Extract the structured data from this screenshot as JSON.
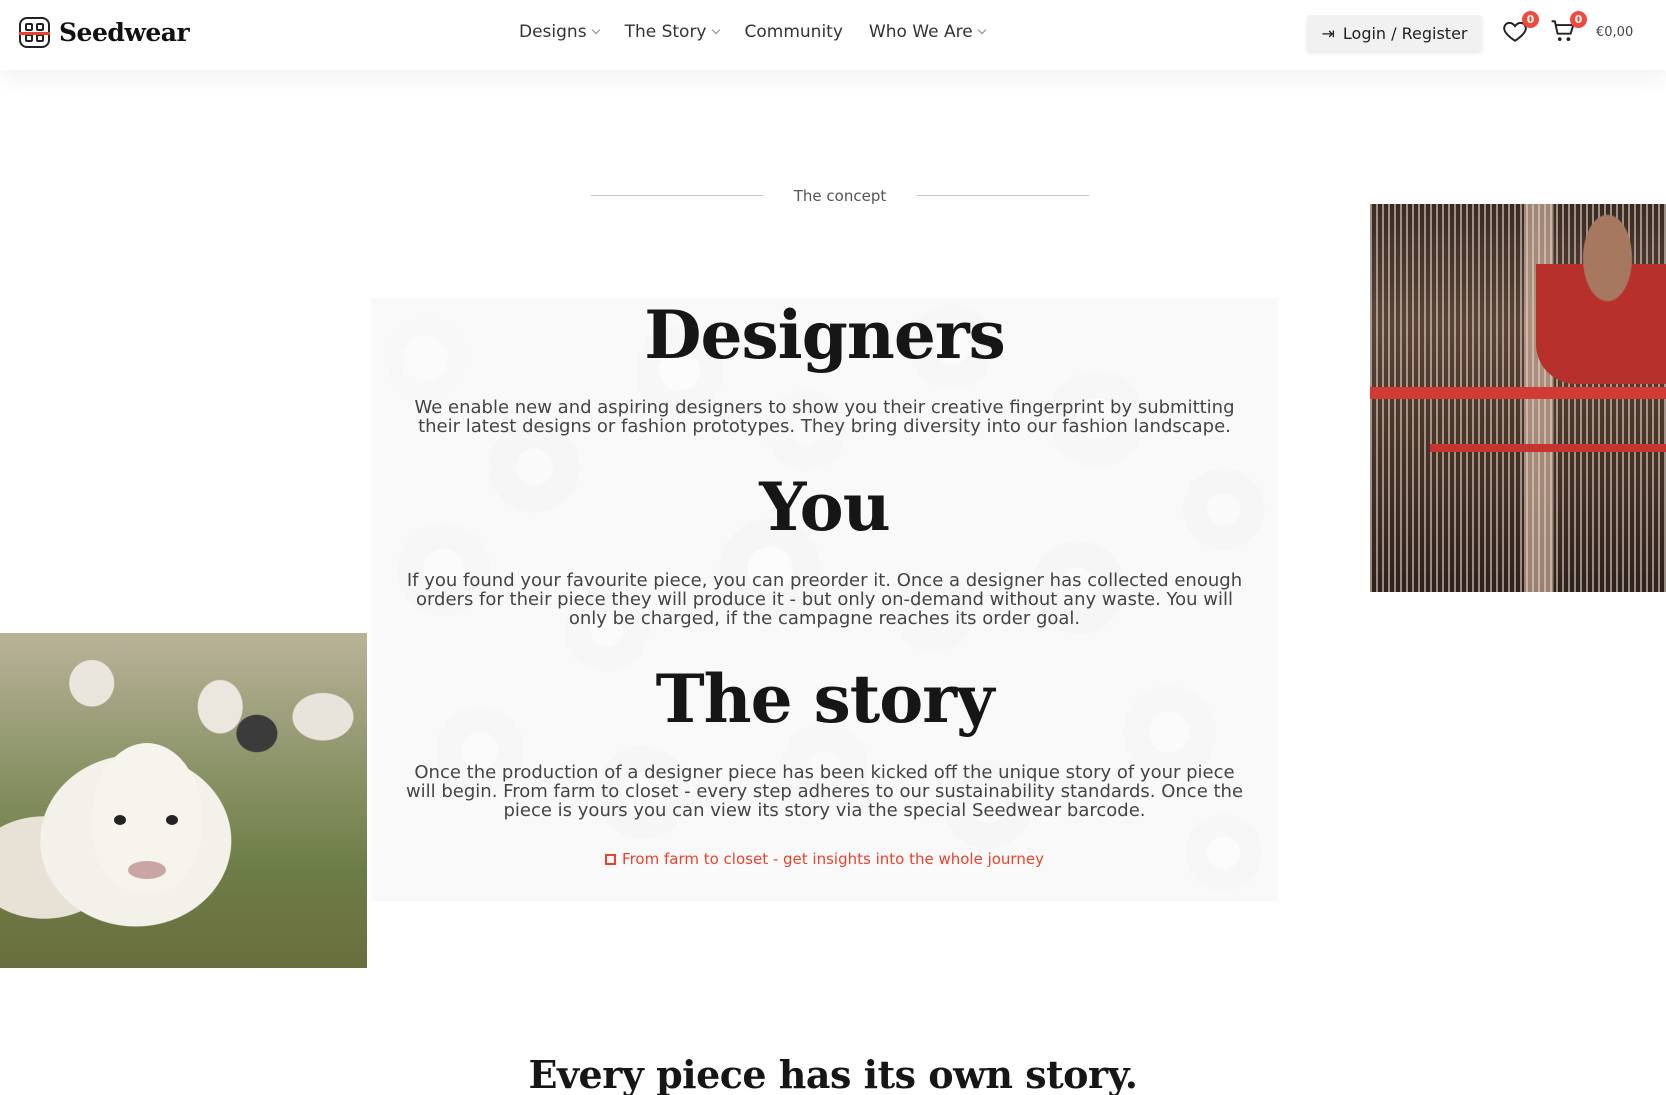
{
  "brand": {
    "name": "Seedwear"
  },
  "nav": [
    {
      "label": "Designs",
      "has_dropdown": true
    },
    {
      "label": "The Story",
      "has_dropdown": true
    },
    {
      "label": "Community",
      "has_dropdown": false
    },
    {
      "label": "Who We Are",
      "has_dropdown": true
    }
  ],
  "header": {
    "login_label": "Login / Register",
    "wishlist_count": "0",
    "cart_count": "0",
    "cart_total": "€0,00"
  },
  "concept": {
    "label": "The concept",
    "sections": [
      {
        "title": "Designers",
        "body": "We enable new and aspiring designers to show you their creative fingerprint by submitting their latest designs or fashion prototypes. They bring diversity into our fashion landscape."
      },
      {
        "title": "You",
        "body": "If you found your favourite piece, you can preorder it. Once a designer has collected enough orders for their piece they will produce it - but only on-demand without any waste. You will only be charged, if the campagne reaches its order goal."
      },
      {
        "title": "The story",
        "body": "Once the production of a designer piece has been kicked off the unique story of your piece will begin. From farm to closet - every step adheres to our sustainability standards. Once the piece is yours you can view its story via the special Seedwear barcode."
      }
    ],
    "link_label": "From farm to closet - get insights into the whole journey"
  },
  "bottom": {
    "title": "Every piece has its own story."
  },
  "colors": {
    "accent": "#e8432f",
    "badge": "#f04a3d"
  }
}
